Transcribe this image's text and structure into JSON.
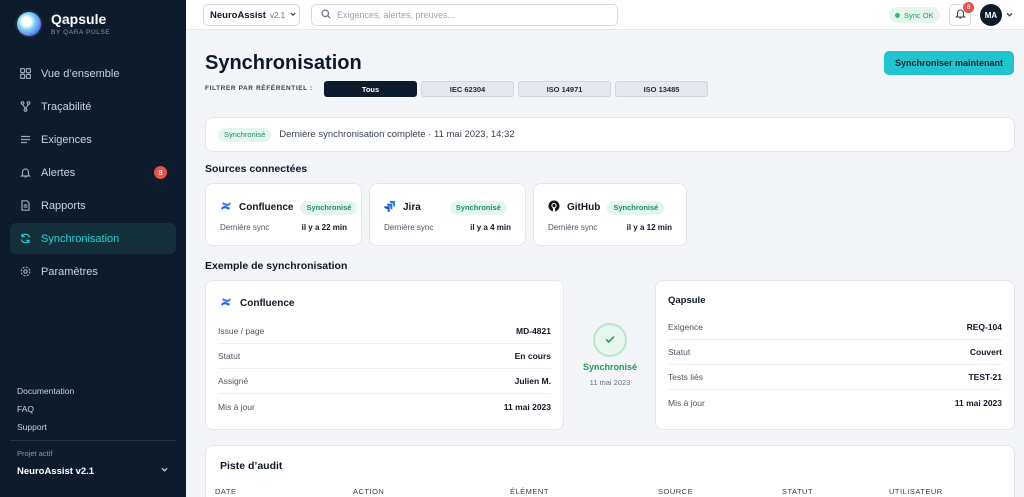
{
  "brand": {
    "name": "Qapsule",
    "subtitle": "BY QARA PULSE"
  },
  "sidebar": {
    "items": [
      {
        "label": "Vue d’ensemble",
        "icon": "grid-icon"
      },
      {
        "label": "Traçabilité",
        "icon": "branch-icon"
      },
      {
        "label": "Exigences",
        "icon": "list-icon"
      },
      {
        "label": "Alertes",
        "icon": "bell-icon",
        "badge": "8"
      },
      {
        "label": "Rapports",
        "icon": "document-icon"
      },
      {
        "label": "Synchronisation",
        "icon": "sync-icon",
        "active": true
      },
      {
        "label": "Paramètres",
        "icon": "gear-icon"
      }
    ],
    "footer_links": [
      "Documentation",
      "FAQ",
      "Support"
    ],
    "project_label": "Projet actif",
    "project_name": "NeuroAssist v2.1"
  },
  "topbar": {
    "app_name": "NeuroAssist",
    "app_version": "v2.1",
    "search_placeholder": "Exigences, alertes, preuves...",
    "sync_status": "Sync OK",
    "notification_count": "8",
    "avatar_initials": "MA"
  },
  "page": {
    "title": "Synchronisation",
    "primary_action": "Synchroniser maintenant",
    "filter_label": "FILTRER PAR RÉFÉRENTIEL :",
    "filters": [
      "Tous",
      "IEC 62304",
      "ISO 14971",
      "ISO 13485"
    ],
    "active_filter": "Tous"
  },
  "banner": {
    "badge": "Synchronisé",
    "text": "Dernière synchronisation complète · 11 mai 2023, 14:32"
  },
  "sources": {
    "title": "Sources connectées",
    "items": [
      {
        "name": "Confluence",
        "status": "Synchronisé",
        "sync_label": "Dernière sync",
        "sync_value": "il y a 22 min"
      },
      {
        "name": "Jira",
        "status": "Synchronisé",
        "sync_label": "Dernière sync",
        "sync_value": "il y a 4 min"
      },
      {
        "name": "GitHub",
        "status": "Synchronisé",
        "sync_label": "Dernière sync",
        "sync_value": "il y a 12 min"
      }
    ]
  },
  "example": {
    "title": "Exemple de synchronisation",
    "left": {
      "title": "Confluence",
      "rows": [
        {
          "label": "Issue / page",
          "value": "MD-4821"
        },
        {
          "label": "Statut",
          "value": "En cours"
        },
        {
          "label": "Assigné",
          "value": "Julien M."
        },
        {
          "label": "Mis à jour",
          "value": "11 mai 2023"
        }
      ]
    },
    "middle": {
      "label": "Synchronisé",
      "date": "11 mai 2023"
    },
    "right": {
      "title": "Qapsule",
      "rows": [
        {
          "label": "Exigence",
          "value": "REQ-104"
        },
        {
          "label": "Statut",
          "value": "Couvert"
        },
        {
          "label": "Tests liés",
          "value": "TEST-21"
        },
        {
          "label": "Mis à jour",
          "value": "11 mai 2023"
        }
      ]
    }
  },
  "audit": {
    "title": "Piste d’audit",
    "columns": [
      "DATE",
      "ACTION",
      "ÉLÉMENT",
      "SOURCE",
      "STATUT",
      "UTILISATEUR"
    ]
  },
  "colors": {
    "accent": "#22c4cd",
    "sidebar": "#0d1b2a",
    "success": "#1f9d57",
    "danger": "#e5534b"
  }
}
